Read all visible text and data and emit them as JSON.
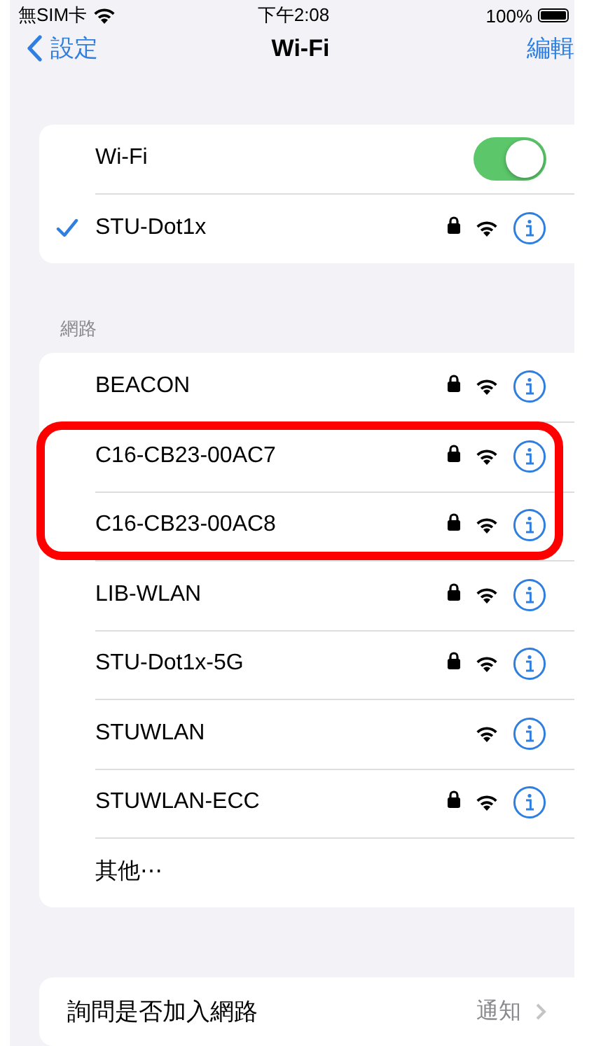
{
  "status_bar": {
    "carrier": "無SIM卡",
    "time": "下午2:08",
    "battery": "100%"
  },
  "nav": {
    "back": "設定",
    "title": "Wi-Fi",
    "action": "編輯"
  },
  "wifi": {
    "label": "Wi-Fi",
    "on": true
  },
  "current": {
    "name": "STU-Dot1x",
    "checked": true,
    "locked": true
  },
  "section_header": "網路",
  "networks": [
    {
      "name": "BEACON",
      "locked": true,
      "highlighted": false
    },
    {
      "name": "C16-CB23-00AC7",
      "locked": true,
      "highlighted": true
    },
    {
      "name": "C16-CB23-00AC8",
      "locked": true,
      "highlighted": true
    },
    {
      "name": "LIB-WLAN",
      "locked": true,
      "highlighted": false
    },
    {
      "name": "STU-Dot1x-5G",
      "locked": true,
      "highlighted": false
    },
    {
      "name": "STUWLAN",
      "locked": false,
      "highlighted": false
    },
    {
      "name": "STUWLAN-ECC",
      "locked": true,
      "highlighted": false
    }
  ],
  "other": "其他⋯",
  "ask_join": {
    "label": "詢問是否加入網路",
    "value": "通知"
  }
}
